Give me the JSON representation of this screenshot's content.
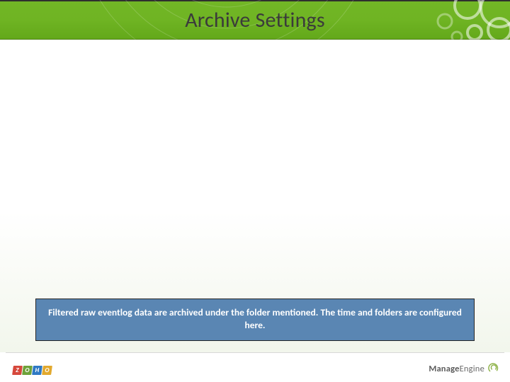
{
  "title": "Archive Settings",
  "description": "Filtered raw eventlog data are archived under the folder mentioned. The time and folders are configured here.",
  "footer": {
    "left_logo": "ZOHO",
    "right_logo_prefix": "Manage",
    "right_logo_suffix": "Engine"
  },
  "colors": {
    "header_green": "#6fb423",
    "desc_box_bg": "#5a86b3",
    "desc_box_border": "#262626"
  }
}
